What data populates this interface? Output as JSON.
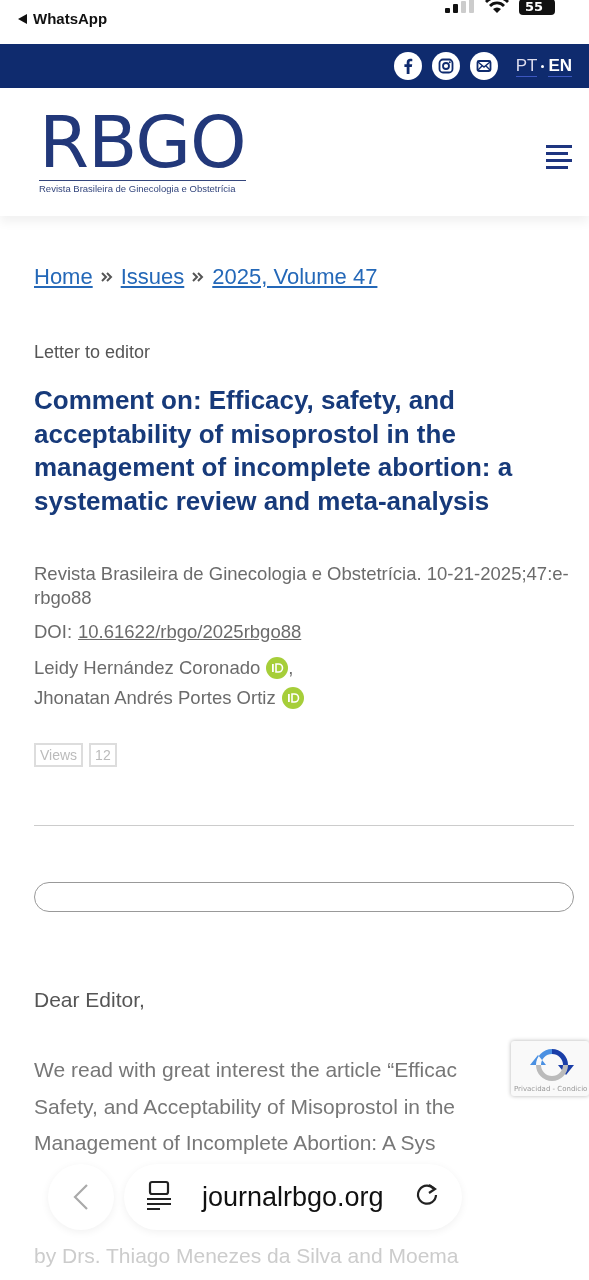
{
  "status_bar": {
    "back_app": "WhatsApp",
    "battery": "55"
  },
  "top_bar": {
    "social": [
      {
        "kind": "facebook"
      },
      {
        "kind": "instagram"
      },
      {
        "kind": "email"
      }
    ],
    "languages": [
      {
        "label": "PT",
        "selected": false
      },
      {
        "label": "EN",
        "selected": true
      }
    ]
  },
  "header": {
    "logo": "RBGO",
    "logo_subtitle": "Revista Brasileira de Ginecologia e Obstetrícia"
  },
  "breadcrumb": [
    "Home",
    "Issues",
    "2025, Volume 47"
  ],
  "article": {
    "type": "Letter to editor",
    "title": "Comment on: Efficacy, safety, and acceptability of misoprostol in the management of incomplete abortion: a systematic review and meta-analysis",
    "citation": "Revista Brasileira de Ginecologia e Obstetrícia. 10-21-2025;47:e-rbgo88",
    "doi_label": "DOI:",
    "doi": "10.61622/rbgo/2025rbgo88",
    "authors": [
      {
        "name": "Leidy Hernández Coronado",
        "separator": ","
      },
      {
        "name": "Jhonatan Andrés Portes Ortiz"
      }
    ],
    "views_label": "Views",
    "views": "12"
  },
  "body": {
    "salutation": "Dear Editor,",
    "lines": [
      "We read with great interest the article “Efficac",
      "Safety, and Acceptability of Misoprostol in the",
      "Management of Incomplete Abortion: A Sys"
    ],
    "tail_line": "by Drs. Thiago Menezes da Silva and Moema"
  },
  "recaptcha": {
    "text": "Privacidad - Condicio"
  },
  "browser_bar": {
    "url": "journalrbgo.org"
  }
}
